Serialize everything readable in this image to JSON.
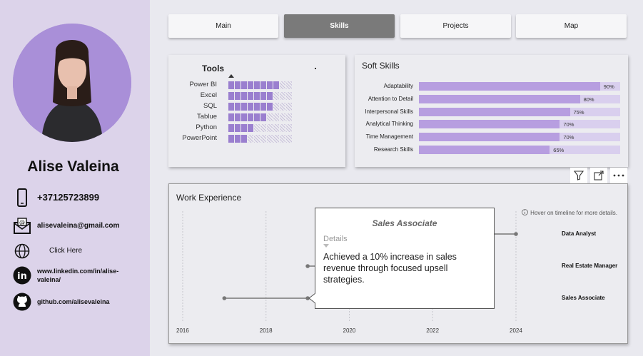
{
  "profile": {
    "name": "Alise Valeina",
    "phone": "+37125723899",
    "email": "alisevaleina@gmail.com",
    "website": "Click Here",
    "linkedin": "www.linkedin.com/in/alise-valeina/",
    "github": "github.com/alisevaleina"
  },
  "nav": {
    "tabs": [
      {
        "label": "Main"
      },
      {
        "label": "Skills"
      },
      {
        "label": "Projects"
      },
      {
        "label": "Map"
      }
    ],
    "active": "Skills"
  },
  "tools": {
    "title": "Tools",
    "max_level": 10,
    "items": [
      {
        "label": "Power BI",
        "level": 8
      },
      {
        "label": "Excel",
        "level": 7
      },
      {
        "label": "SQL",
        "level": 7
      },
      {
        "label": "Tablue",
        "level": 6
      },
      {
        "label": "Python",
        "level": 4
      },
      {
        "label": "PowerPoint",
        "level": 3
      }
    ]
  },
  "soft_skills": {
    "title": "Soft Skills",
    "items": [
      {
        "label": "Adaptability",
        "value": 90,
        "display": "90%"
      },
      {
        "label": "Attention to Detail",
        "value": 80,
        "display": "80%"
      },
      {
        "label": "Interpersonal Skills",
        "value": 75,
        "display": "75%"
      },
      {
        "label": "Analytical Thinking",
        "value": 70,
        "display": "70%"
      },
      {
        "label": "Time Management",
        "value": 70,
        "display": "70%"
      },
      {
        "label": "Research Skills",
        "value": 65,
        "display": "65%"
      }
    ]
  },
  "work": {
    "title": "Work Experience",
    "hint": "Hover on timeline for more details.",
    "years": [
      "2016",
      "2018",
      "2020",
      "2022",
      "2024"
    ],
    "roles": [
      {
        "label": "Data Analyst",
        "start": 2022.0,
        "end": 2024.0
      },
      {
        "label": "Real Estate Manager",
        "start": 2019.0,
        "end": 2022.0
      },
      {
        "label": "Sales Associate",
        "start": 2017.0,
        "end": 2019.0
      }
    ],
    "tooltip": {
      "title": "Sales Associate",
      "subtitle": "Details",
      "body": "Achieved a 10% increase in sales revenue through focused upsell strategies."
    }
  },
  "colors": {
    "sidebar": "#dcd3ea",
    "accent": "#9a7fcf",
    "bar_fill": "#b79ee0",
    "bar_track": "#d9cfee",
    "active_tab": "#7a7a7a"
  }
}
